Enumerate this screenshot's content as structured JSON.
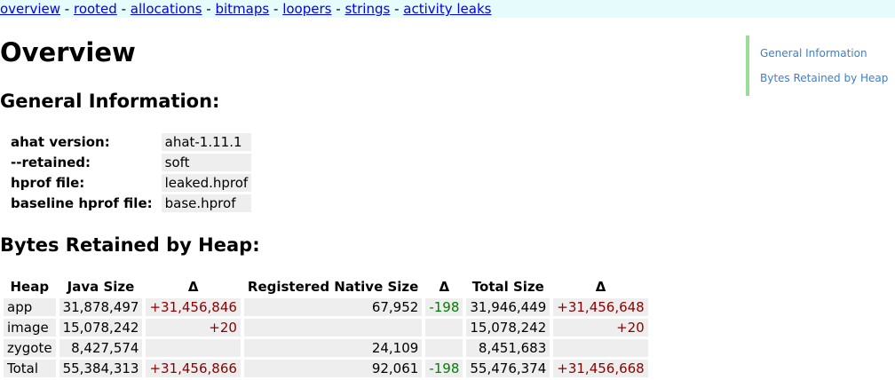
{
  "menu": {
    "links": [
      "overview",
      "rooted",
      "allocations",
      "bitmaps",
      "loopers",
      "strings",
      "activity leaks"
    ],
    "separator": "-"
  },
  "page_title": "Overview",
  "sections": {
    "general": "General Information:",
    "bytes": "Bytes Retained by Heap:"
  },
  "toc": [
    "General Information",
    "Bytes Retained by Heap"
  ],
  "info": [
    {
      "key": "ahat version:",
      "value": "ahat-1.11.1"
    },
    {
      "key": "--retained:",
      "value": "soft"
    },
    {
      "key": "hprof file:",
      "value": "leaked.hprof"
    },
    {
      "key": "baseline hprof file:",
      "value": "base.hprof"
    }
  ],
  "heap_table": {
    "headers": [
      "Heap",
      "Java Size",
      "Δ",
      "Registered Native Size",
      "Δ",
      "Total Size",
      "Δ"
    ],
    "rows": [
      [
        "app",
        "31,878,497",
        "+31,456,846",
        "67,952",
        "-198",
        "31,946,449",
        "+31,456,648"
      ],
      [
        "image",
        "15,078,242",
        "+20",
        "",
        "",
        "15,078,242",
        "+20"
      ],
      [
        "zygote",
        "8,427,574",
        "",
        "24,109",
        "",
        "8,451,683",
        ""
      ],
      [
        "Total",
        "55,384,313",
        "+31,456,866",
        "92,061",
        "-198",
        "55,476,374",
        "+31,456,668"
      ]
    ]
  },
  "colors": {
    "positive_delta": "#8b0000",
    "negative_delta": "#008000",
    "menu_background": "#e6fbfb",
    "toc_border": "#99dd99",
    "cell_background": "#eeeeee"
  }
}
